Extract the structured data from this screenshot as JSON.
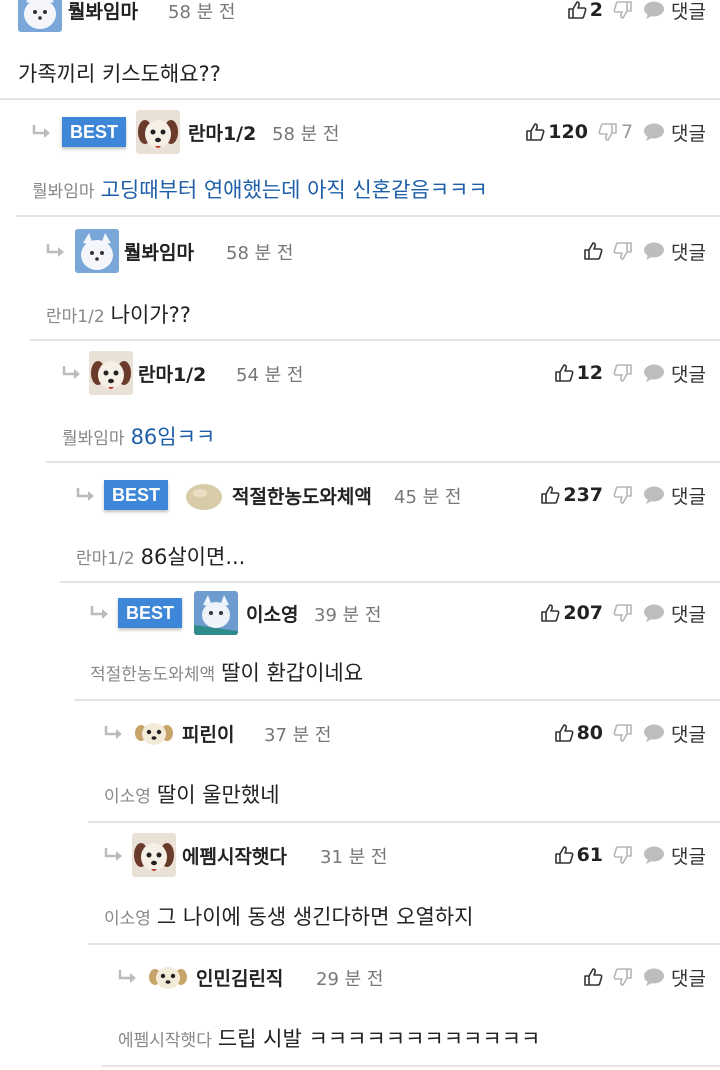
{
  "comments": [
    {
      "user": "뤌봐임마",
      "time": "58 분 전",
      "upvotes": "2",
      "downvotes": "",
      "reply_label": "댓글",
      "mention": "",
      "text": "가족끼리 키스도해요??",
      "best": "",
      "avatar": "fox-avatar-icon"
    },
    {
      "user": "란마1/2",
      "time": "58 분 전",
      "upvotes": "120",
      "downvotes": "7",
      "reply_label": "댓글",
      "mention": "뤌봐임마",
      "text": "고딩때부터 연애했는데 아직 신혼같음ㅋㅋㅋ",
      "best": "BEST",
      "avatar": "puppy-brown-avatar-icon"
    },
    {
      "user": "뤌봐임마",
      "time": "58 분 전",
      "upvotes": "",
      "downvotes": "",
      "reply_label": "댓글",
      "mention": "란마1/2",
      "text": "나이가??",
      "best": "",
      "avatar": "fox-avatar-icon"
    },
    {
      "user": "란마1/2",
      "time": "54 분 전",
      "upvotes": "12",
      "downvotes": "",
      "reply_label": "댓글",
      "mention": "뤌봐임마",
      "text": "86임ㅋㅋ",
      "best": "",
      "avatar": "puppy-brown-avatar-icon"
    },
    {
      "user": "적절한농도와체액",
      "time": "45 분 전",
      "upvotes": "237",
      "downvotes": "",
      "reply_label": "댓글",
      "mention": "란마1/2",
      "text": "86살이면...",
      "best": "BEST",
      "avatar": "rice-ball-avatar-icon"
    },
    {
      "user": "이소영",
      "time": "39 분 전",
      "upvotes": "207",
      "downvotes": "",
      "reply_label": "댓글",
      "mention": "적절한농도와체액",
      "text": "딸이 환갑이네요",
      "best": "BEST",
      "avatar": "fox-snow-avatar-icon"
    },
    {
      "user": "피린이",
      "time": "37 분 전",
      "upvotes": "80",
      "downvotes": "",
      "reply_label": "댓글",
      "mention": "이소영",
      "text": "딸이 울만했네",
      "best": "",
      "avatar": "puppy-small-avatar-icon"
    },
    {
      "user": "에펨시작햇다",
      "time": "31 분 전",
      "upvotes": "61",
      "downvotes": "",
      "reply_label": "댓글",
      "mention": "이소영",
      "text": "그 나이에 동생 생긴다하면 오열하지",
      "best": "",
      "avatar": "puppy-brown-avatar-icon"
    },
    {
      "user": "인민김린직",
      "time": "29 분 전",
      "upvotes": "",
      "downvotes": "",
      "reply_label": "댓글",
      "mention": "에펨시작햇다",
      "text": "드립 시발 ㅋㅋㅋㅋㅋㅋㅋㅋㅋㅋㅋㅋ",
      "best": "",
      "avatar": "puppy-small-avatar-icon"
    }
  ],
  "colors": {
    "best_badge": "#3d86d8",
    "mention_link": "#1e5fa8",
    "divider": "#e3e3e3"
  }
}
